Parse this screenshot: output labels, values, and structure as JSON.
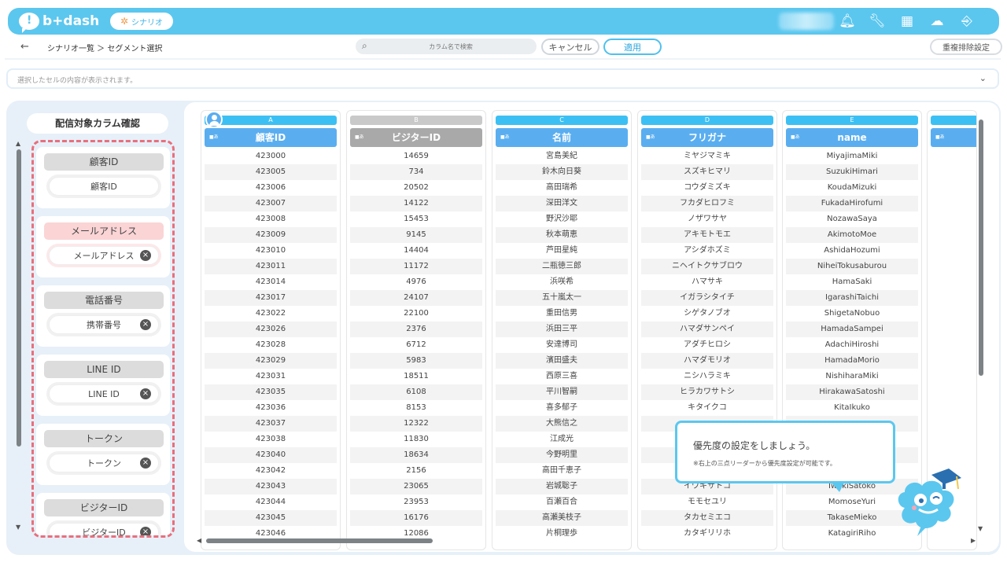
{
  "header": {
    "logo_text": "b+dash",
    "scenario_label": "シナリオ",
    "icons": [
      "bell-icon",
      "wrench-icon",
      "grid-icon",
      "mascot-chat-icon",
      "logout-icon"
    ]
  },
  "subheader": {
    "breadcrumb": "シナリオ一覧 ＞ セグメント選択",
    "search_placeholder": "カラム名で検索",
    "cancel_label": "キャンセル",
    "apply_label": "適用",
    "dedup_label": "重複排除設定"
  },
  "cellbar": {
    "placeholder": "選択したセルの内容が表示されます。"
  },
  "left_panel": {
    "title": "配信対象カラム確認",
    "cards": [
      {
        "title": "顧客ID",
        "field": "顧客ID",
        "removable": false,
        "highlight": false
      },
      {
        "title": "メールアドレス",
        "field": "メールアドレス",
        "removable": true,
        "highlight": true
      },
      {
        "title": "電話番号",
        "field": "携帯番号",
        "removable": true,
        "highlight": false
      },
      {
        "title": "LINE ID",
        "field": "LINE ID",
        "removable": true,
        "highlight": false
      },
      {
        "title": "トークン",
        "field": "トークン",
        "removable": true,
        "highlight": false
      },
      {
        "title": "ビジターID",
        "field": "ビジターID",
        "removable": true,
        "highlight": false
      }
    ]
  },
  "table": {
    "type_tag": "■あ",
    "columns": [
      {
        "letter": "A",
        "header": "顧客ID",
        "muted": false,
        "cells": [
          "423000",
          "423005",
          "423006",
          "423007",
          "423008",
          "423009",
          "423010",
          "423011",
          "423014",
          "423017",
          "423022",
          "423026",
          "423028",
          "423029",
          "423031",
          "423035",
          "423036",
          "423037",
          "423038",
          "423040",
          "423042",
          "423043",
          "423044",
          "423045",
          "423046"
        ]
      },
      {
        "letter": "B",
        "header": "ビジターID",
        "muted": true,
        "cells": [
          "14659",
          "734",
          "20502",
          "14122",
          "15453",
          "9145",
          "14404",
          "11172",
          "4976",
          "24107",
          "22100",
          "2376",
          "6712",
          "5983",
          "18511",
          "6108",
          "8153",
          "12322",
          "11830",
          "18634",
          "2156",
          "23065",
          "23953",
          "16176",
          "12086"
        ]
      },
      {
        "letter": "C",
        "header": "名前",
        "muted": false,
        "cells": [
          "宮島美紀",
          "鈴木向日葵",
          "高田瑞希",
          "深田洋文",
          "野沢沙耶",
          "秋本萌恵",
          "芦田星純",
          "二瓶徳三郎",
          "浜咲希",
          "五十嵐太一",
          "重田信男",
          "浜田三平",
          "安達博司",
          "濱田盛夫",
          "西原三喜",
          "平川智嗣",
          "喜多郁子",
          "大熊信之",
          "江成光",
          "今野明里",
          "高田千恵子",
          "岩城聡子",
          "百瀬百合",
          "高瀬美枝子",
          "片桐理歩"
        ]
      },
      {
        "letter": "D",
        "header": "フリガナ",
        "muted": false,
        "cells": [
          "ミヤジマミキ",
          "スズキヒマリ",
          "コウダミズキ",
          "フカダヒロフミ",
          "ノザワサヤ",
          "アキモトモエ",
          "アシダホズミ",
          "ニヘイトクサブロウ",
          "ハマサキ",
          "イガラシタイチ",
          "シゲタノブオ",
          "ハマダサンペイ",
          "アダチヒロシ",
          "ハマダモリオ",
          "ニシハラミキ",
          "ヒラカワサトシ",
          "キタイクコ",
          "",
          "",
          "",
          "",
          "イワキサトコ",
          "モモセユリ",
          "タカセミエコ",
          "カタギリリホ"
        ]
      },
      {
        "letter": "E",
        "header": "name",
        "muted": false,
        "cells": [
          "MiyajimaMiki",
          "SuzukiHimari",
          "KoudaMizuki",
          "FukadaHirofumi",
          "NozawaSaya",
          "AkimotoMoe",
          "AshidaHozumi",
          "NiheiTokusaburou",
          "HamaSaki",
          "IgarashiTaichi",
          "ShigetaNobuo",
          "HamadaSampei",
          "AdachiHiroshi",
          "HamadaMorio",
          "NishiharaMiki",
          "HirakawaSatoshi",
          "KitaIkuko",
          "",
          "",
          "",
          "",
          "IwakiSatoko",
          "MomoseYuri",
          "TakaseMieko",
          "KatagiriRiho"
        ]
      }
    ]
  },
  "tooltip": {
    "title": "優先度の設定をしましょう。",
    "body": "※右上の三点リーダーから優先度設定が可能です。"
  },
  "colors": {
    "brand": "#5bc7ef",
    "header_blue": "#5aaef0",
    "dashed_border": "#e86f7d"
  }
}
